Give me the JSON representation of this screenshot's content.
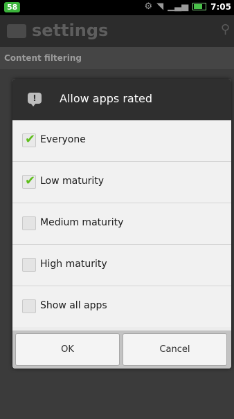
{
  "status_bar": {
    "badge": "58",
    "time": "7:05"
  },
  "app_bar": {
    "title": "settings"
  },
  "background": {
    "section_header": "Content filtering"
  },
  "dialog": {
    "title": "Allow apps rated",
    "options": [
      {
        "label": "Everyone",
        "checked": true
      },
      {
        "label": "Low maturity",
        "checked": true
      },
      {
        "label": "Medium maturity",
        "checked": false
      },
      {
        "label": "High maturity",
        "checked": false
      },
      {
        "label": "Show all apps",
        "checked": false
      }
    ],
    "buttons": {
      "ok": "OK",
      "cancel": "Cancel"
    }
  },
  "colors": {
    "check_accent": "#5fbf1c",
    "header_bg": "#2f2f2f"
  }
}
